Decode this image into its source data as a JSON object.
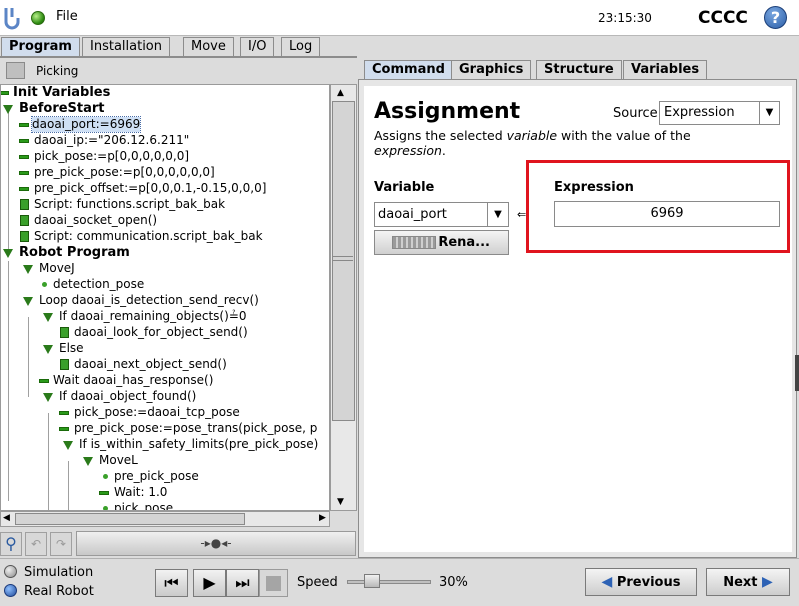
{
  "header": {
    "file_menu": "File",
    "time": "23:15:30",
    "robot_name": "CCCC",
    "help": "?"
  },
  "main_tabs": [
    "Program",
    "Installation",
    "Move",
    "I/O",
    "Log"
  ],
  "program": {
    "name": "Picking"
  },
  "tree": [
    {
      "label": "Init Variables",
      "bold": true
    },
    {
      "label": "BeforeStart",
      "bold": true
    },
    {
      "label": "daoai_port:=6969",
      "selected": true
    },
    {
      "label": "daoai_ip:=\"206.12.6.211\""
    },
    {
      "label": "pick_pose:=p[0,0,0,0,0,0]"
    },
    {
      "label": "pre_pick_pose:=p[0,0,0,0,0,0]"
    },
    {
      "label": "pre_pick_offset:=p[0,0,0.1,-0.15,0,0,0]"
    },
    {
      "label": "Script: functions.script_bak_bak"
    },
    {
      "label": "daoai_socket_open()"
    },
    {
      "label": "Script: communication.script_bak_bak"
    },
    {
      "label": "Robot Program",
      "bold": true
    },
    {
      "label": "MoveJ"
    },
    {
      "label": "detection_pose"
    },
    {
      "label": "Loop daoai_is_detection_send_recv()"
    },
    {
      "label": "If daoai_remaining_objects()≟0"
    },
    {
      "label": "daoai_look_for_object_send()"
    },
    {
      "label": "Else"
    },
    {
      "label": "daoai_next_object_send()"
    },
    {
      "label": "Wait daoai_has_response()"
    },
    {
      "label": "If daoai_object_found()"
    },
    {
      "label": "pick_pose:=daoai_tcp_pose"
    },
    {
      "label": "pre_pick_pose:=pose_trans(pick_pose, p"
    },
    {
      "label": "If is_within_safety_limits(pre_pick_pose)"
    },
    {
      "label": "MoveL"
    },
    {
      "label": "pre_pick_pose"
    },
    {
      "label": "Wait: 1.0"
    },
    {
      "label": "pick_pose"
    }
  ],
  "toolbar": {
    "slider_glyph": "-▸●◂-"
  },
  "sub_tabs": [
    "Command",
    "Graphics",
    "Structure",
    "Variables"
  ],
  "assignment": {
    "title": "Assignment",
    "source_label": "Source",
    "source_value": "Expression",
    "desc_1": "Assigns the selected ",
    "desc_var": "variable",
    "desc_2": " with the value of the",
    "desc_expr": "expression",
    "desc_3": ".",
    "variable_label": "Variable",
    "variable_value": "daoai_port",
    "rename_label": "Rena...",
    "assign_symbol": "⇐",
    "expression_label": "Expression",
    "expression_value": "6969"
  },
  "footer": {
    "simulation": "Simulation",
    "real_robot": "Real Robot",
    "speed_label": "Speed",
    "speed_value": "30%",
    "speed_fraction": 0.3,
    "previous": "Previous",
    "next": "Next"
  },
  "colors": {
    "accent_blue": "#2d62b5",
    "highlight_red": "#e0141e",
    "node_green": "#2a9a1a"
  }
}
